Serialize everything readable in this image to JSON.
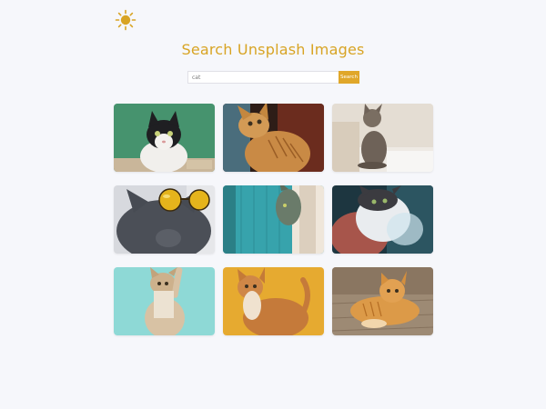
{
  "header": {
    "theme_icon": "sun-icon",
    "title": "Search Unsplash Images"
  },
  "search": {
    "value": "cat",
    "button_label": "Search"
  },
  "colors": {
    "accent": "#e0a72a",
    "title": "#d8a424",
    "background": "#f6f7fb"
  },
  "results": [
    {
      "subject": "black and white cat on green background"
    },
    {
      "subject": "orange tabby cat looking up"
    },
    {
      "subject": "grey cat sitting on white surface"
    },
    {
      "subject": "grey cat wearing yellow sunglasses"
    },
    {
      "subject": "cat peeking behind teal door"
    },
    {
      "subject": "fluffy cat with red and blue light"
    },
    {
      "subject": "cat reaching up on light blue background"
    },
    {
      "subject": "orange cat on yellow background"
    },
    {
      "subject": "orange tabby cat lying on wood floor"
    }
  ]
}
